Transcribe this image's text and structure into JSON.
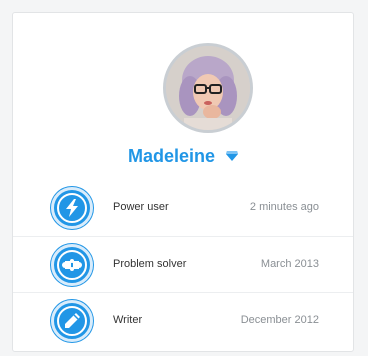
{
  "profile": {
    "name": "Madeleine",
    "name_color": "#2196e6",
    "badge_icon": "diamond-icon",
    "avatar": "avatar-photo"
  },
  "achievements": [
    {
      "title": "Power user",
      "time": "2 minutes ago",
      "icon": "lightning-bolt-icon"
    },
    {
      "title": "Problem solver",
      "time": "March 2013",
      "icon": "puzzle-piece-icon"
    },
    {
      "title": "Writer",
      "time": "December 2012",
      "icon": "pencil-icon"
    }
  ],
  "colors": {
    "accent": "#2196e6",
    "text": "#333333",
    "muted": "#8a8f94"
  }
}
